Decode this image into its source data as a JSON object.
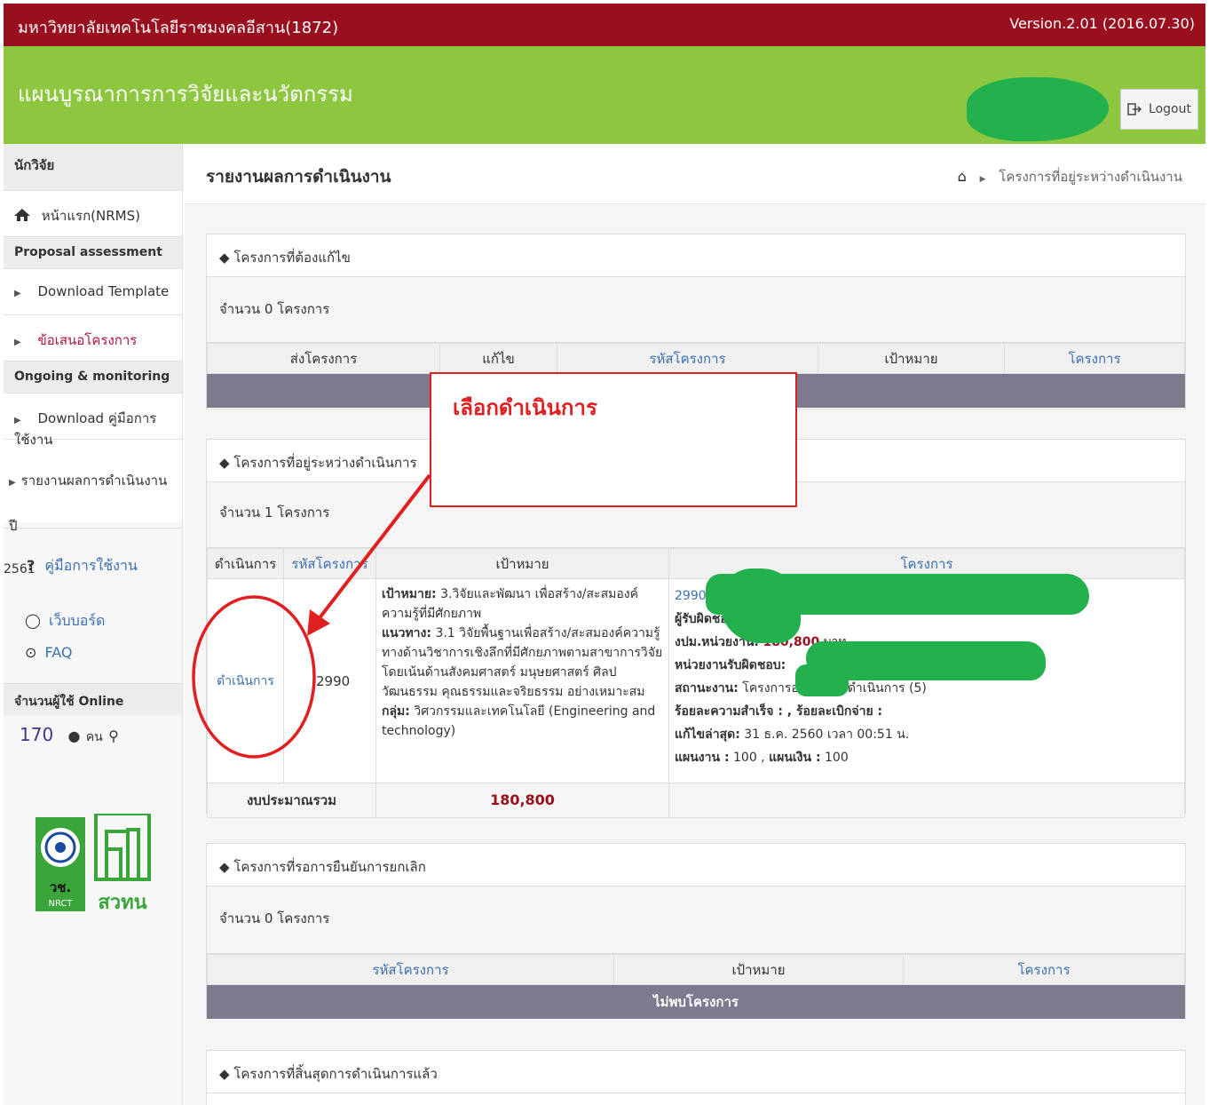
{
  "topbar": {
    "university": "มหาวิทยาลัยเทคโนโลยีราชมงคลอีสาน(1872)",
    "version": "Version.2.01 (2016.07.30)"
  },
  "header": {
    "title": "แผนบูรณาการการวิจัยและนวัตกรรม",
    "logout_label": "Logout"
  },
  "sidebar": {
    "role": "นักวิจัย",
    "home": "หน้าแรก(NRMS)",
    "section_proposal": "Proposal assessment",
    "download_template": "Download Template",
    "proposal": "ข้อเสนอโครงการ",
    "section_ongoing": "Ongoing & monitoring",
    "download_manual": "Download คู่มือการใช้งาน",
    "annual_report": "รายงานผลการดำเนินงานปี",
    "annual_year": "2561",
    "manual": "คู่มือการใช้งาน",
    "webboard": "เว็บบอร์ด",
    "faq": "FAQ",
    "online_label": "จำนวนผู้ใช้ Online",
    "online_count": "170",
    "online_unit": "คน",
    "logo_text": "สวทน"
  },
  "page": {
    "title": "รายงานผลการดำเนินงาน",
    "breadcrumb": "โครงการที่อยู่ระหว่างดำเนินงาน"
  },
  "panel_revise": {
    "title": "โครงการที่ต้องแก้ไข",
    "count": "จำนวน 0 โครงการ",
    "columns": [
      "ส่งโครงการ",
      "แก้ไข",
      "รหัสโครงการ",
      "เป้าหมาย",
      "โครงการ"
    ]
  },
  "panel_ongoing": {
    "title": "โครงการที่อยู่ระหว่างดำเนินการ",
    "count": "จำนวน 1 โครงการ",
    "columns": [
      "ดำเนินการ",
      "รหัสโครงการ",
      "เป้าหมาย",
      "โครงการ"
    ],
    "row": {
      "action": "ดำเนินการ",
      "code": "2990",
      "goal_label": "เป้าหมาย:",
      "goal_text": "3.วิจัยและพัฒนา เพื่อสร้าง/สะสมองค์ความรู้ที่มีศักยภาพ",
      "approach_label": "แนวทาง:",
      "approach_text": "3.1 วิจัยพื้นฐานเพื่อสร้าง/สะสมองค์ความรู้ทางด้านวิชาการเชิงลึกที่มีศักยภาพตามสาขาการวิจัย โดยเน้นด้านสังคมศาสตร์ มนุษยศาสตร์ ศิลปวัฒนธรรม คุณธรรมและจริยธรรม อย่างเหมาะสม",
      "group_label": "กลุ่ม:",
      "group_text": "วิศวกรรมและเทคโนโลยี (Engineering and technology)",
      "project_code": "2990",
      "responsible_label": "ผู้รับผิดชอบ:",
      "budget_label": "งปม.หน่วยงาน:",
      "budget_value": "180,800",
      "budget_unit": "บาท",
      "unit_label": "หน่วยงานรับผิดชอบ:",
      "status_label": "สถานะงาน:",
      "status_text": "โครงการอยู่ระหว่างดำเนินการ (5)",
      "progress_label": "ร้อยละความสำเร็จ : , ร้อยละเบิกจ่าย :",
      "edited_label": "แก้ไขล่าสุด:",
      "edited_text": "31 ธ.ค. 2560 เวลา 00:51 น.",
      "plan_label": "แผนงาน :",
      "plan_value": "100",
      "money_label": "แผนเงิน :",
      "money_value": "100"
    },
    "total_label": "งบประมาณรวม",
    "total_value": "180,800"
  },
  "panel_cancel": {
    "title": "โครงการที่รอการยืนยันการยกเลิก",
    "count": "จำนวน 0 โครงการ",
    "columns": [
      "รหัสโครงการ",
      "เป้าหมาย",
      "โครงการ"
    ],
    "empty": "ไม่พบโครงการ"
  },
  "panel_finished": {
    "title": "โครงการที่สิ้นสุดการดำเนินการแล้ว"
  },
  "callout": {
    "text": "เลือกดำเนินการ"
  },
  "colors": {
    "topbar": "#9a0f1e",
    "header": "#8dc63f",
    "annotation": "#e02020",
    "link": "#3a6fb0",
    "value": "#9a0f1e"
  }
}
